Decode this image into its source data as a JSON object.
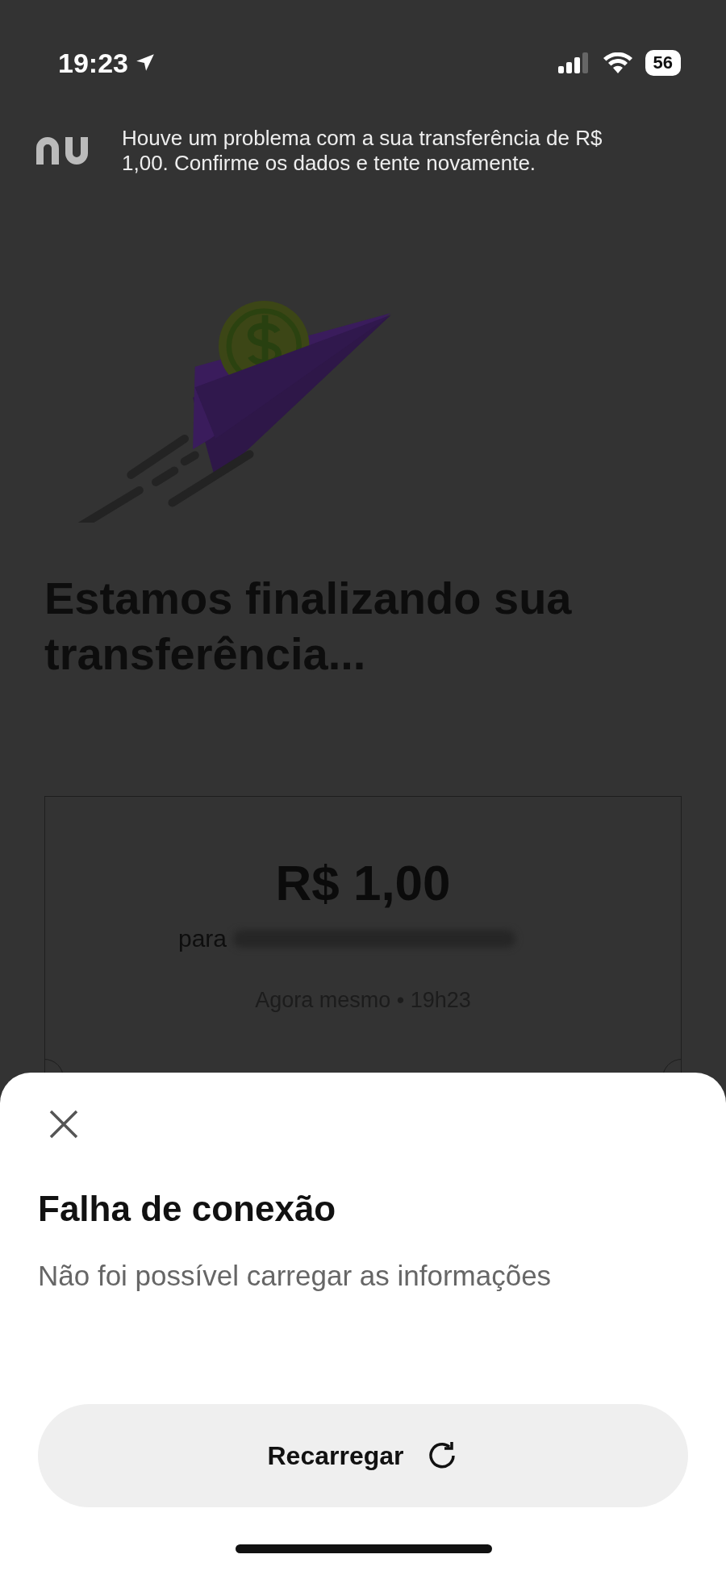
{
  "status_bar": {
    "time": "19:23",
    "battery": "56"
  },
  "notification": {
    "message": "Houve um problema com a sua transferência de R$ 1,00. Confirme os dados e tente novamente."
  },
  "heading": "Estamos finalizando sua transferência...",
  "receipt": {
    "amount": "R$ 1,00",
    "recipient_prefix": "para",
    "timestamp": "Agora mesmo • 19h23"
  },
  "sheet": {
    "title": "Falha de conexão",
    "message": "Não foi possível carregar as informações",
    "button": "Recarregar"
  }
}
